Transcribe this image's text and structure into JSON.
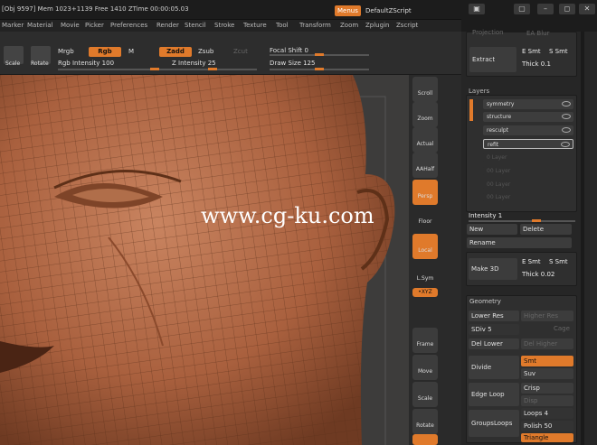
{
  "titlebar": {
    "info": "[Obj 9597]  Mem 1023+1139  Free 1410  ZTime 00:00:05.03",
    "menus": "Menus",
    "script": "DefaultZScript"
  },
  "menubar": [
    "Marker",
    "Material",
    "Movie",
    "Picker",
    "Preferences",
    "Render",
    "Stencil",
    "Stroke",
    "Texture",
    "Tool",
    "Transform",
    "Zoom",
    "Zplugin",
    "Zscript"
  ],
  "toolbar": {
    "scale": "Scale",
    "rotate": "Rotate",
    "mrgb": "Mrgb",
    "rgb": "Rgb",
    "m": "M",
    "zadd": "Zadd",
    "zsub": "Zsub",
    "zcut": "Zcut",
    "rgb_intensity": "Rgb Intensity 100",
    "z_intensity": "Z Intensity 25",
    "focal_shift": "Focal Shift 0",
    "draw_size": "Draw Size 125"
  },
  "watermark": "www.cg-ku.com",
  "shelf": [
    {
      "icon": "scroll-icon",
      "label": "Scroll"
    },
    {
      "icon": "zoom-icon",
      "label": "Zoom"
    },
    {
      "icon": "actual-icon",
      "label": "Actual"
    },
    {
      "icon": "aahalf-icon",
      "label": "AAHalf"
    },
    {
      "icon": "persp-icon",
      "label": "Persp"
    },
    {
      "icon": "floor-icon",
      "label": "Floor"
    },
    {
      "icon": "local-icon",
      "label": "Local"
    },
    {
      "icon": "lsym-icon",
      "label": "L.Sym"
    },
    {
      "icon": "xyz-icon",
      "label": "•XYZ"
    },
    {
      "icon": "frame-icon",
      "label": "Frame"
    },
    {
      "icon": "move-icon",
      "label": "Move"
    },
    {
      "icon": "scale-icon",
      "label": "Scale"
    },
    {
      "icon": "rotate-icon",
      "label": "Rotate"
    }
  ],
  "panel": {
    "top": {
      "projection": "Projection",
      "ea_blur": "EA Blur",
      "extract": "Extract",
      "e_smt": "E Smt",
      "s_smt": "S Smt",
      "thick": "Thick 0.1"
    },
    "layers": {
      "title": "Layers",
      "items": [
        "symmetry",
        "structure",
        "resculpt",
        "refit"
      ],
      "empty": [
        "0 Layer",
        "00 Layer",
        "00 Layer",
        "00 Layer"
      ],
      "intensity": "Intensity 1",
      "new": "New",
      "delete": "Delete",
      "rename": "Rename"
    },
    "make3d": {
      "label": "Make 3D",
      "e_smt": "E Smt",
      "s_smt": "S Smt",
      "thick": "Thick 0.02"
    },
    "geometry": {
      "title": "Geometry",
      "lower_res": "Lower Res",
      "higher_res": "Higher Res",
      "sdiv": "SDiv 5",
      "cage": "Cage",
      "del_lower": "Del Lower",
      "del_higher": "Del Higher",
      "divide": "Divide",
      "smt": "Smt",
      "suv": "Suv",
      "edge_loop": "Edge Loop",
      "crisp": "Crisp",
      "disp": "Disp",
      "groups_loops": "GroupsLoops",
      "loops": "Loops 4",
      "polish": "Polish 50",
      "triangle": "Triangle"
    }
  }
}
